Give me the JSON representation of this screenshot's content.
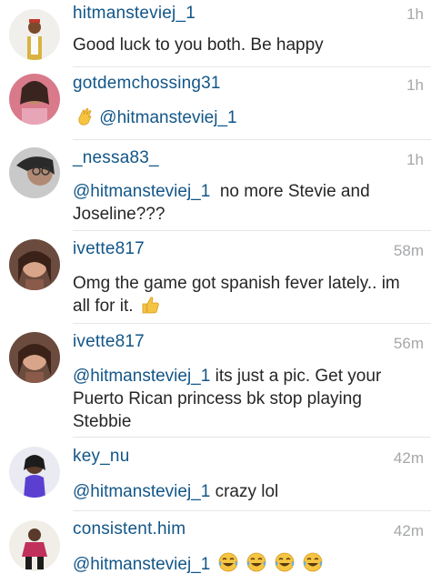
{
  "comments": [
    {
      "username": "hitmansteviej_1",
      "time": "1h",
      "text": "Good luck to you both. Be happy"
    },
    {
      "username": "gotdemchossing31",
      "time": "1h",
      "emoji": "wave",
      "mention": "@hitmansteviej_1",
      "text": ""
    },
    {
      "username": "_nessa83_",
      "time": "1h",
      "mention": "@hitmansteviej_1",
      "text": "  no more Stevie and Joseline???"
    },
    {
      "username": "ivette817",
      "time": "58m",
      "text": "Omg the game got spanish fever lately.. im all for it.",
      "emoji": "thumbs-up"
    },
    {
      "username": "ivette817",
      "time": "56m",
      "mention": "@hitmansteviej_1",
      "text": " its just a pic. Get your Puerto Rican princess bk stop playing Stebbie"
    },
    {
      "username": "key_nu",
      "time": "42m",
      "mention": "@hitmansteviej_1",
      "text": " crazy lol"
    },
    {
      "username": "consistent.him",
      "time": "42m",
      "mention": "@hitmansteviej_1",
      "text": "",
      "emoji": "tears-of-joy x4"
    }
  ],
  "colors": {
    "username": "#125688",
    "time": "#a5a7aa",
    "text": "#262626",
    "divider": "#e6e6e6"
  }
}
